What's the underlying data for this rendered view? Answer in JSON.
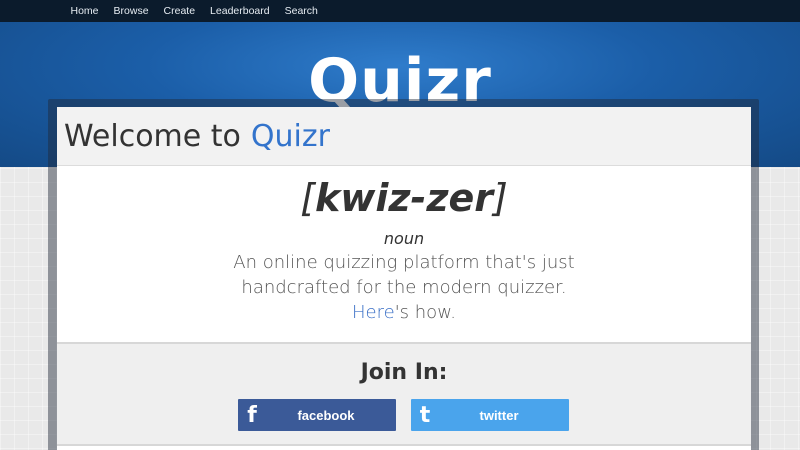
{
  "nav": {
    "items": [
      "Home",
      "Browse",
      "Create",
      "Leaderboard",
      "Search"
    ]
  },
  "logo": {
    "text": "Quizr"
  },
  "welcome": {
    "prefix": "Welcome to",
    "brand": "Quizr"
  },
  "definition": {
    "pronunciation_open": "[",
    "pronunciation": "kwiz-zer",
    "pronunciation_close": "]",
    "part_of_speech": "noun",
    "line1": "An online quizzing platform that's just",
    "line2": "handcrafted for the modern quizzer.",
    "link_text": "Here",
    "link_suffix": "'s how."
  },
  "join": {
    "title": "Join In:",
    "facebook_label": "facebook",
    "twitter_label": "twitter"
  },
  "colors": {
    "nav_bg": "#0b1b2c",
    "hero_blue": "#1b5ea8",
    "brand_blue": "#3374cc",
    "facebook": "#3b5a98",
    "twitter": "#4aa4ec"
  }
}
